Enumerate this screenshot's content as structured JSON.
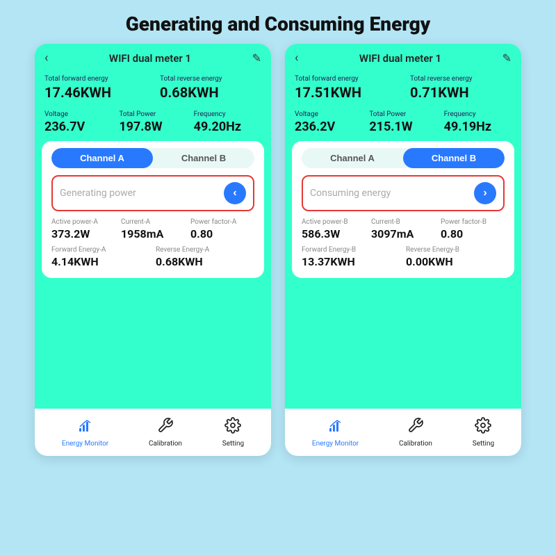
{
  "page": {
    "title": "Generating and Consuming Energy",
    "background": "#b3e5f5"
  },
  "phone_left": {
    "header": {
      "back": "‹",
      "title": "WIFI dual meter 1",
      "edit": "✎"
    },
    "total_forward_label": "Total  forward energy",
    "total_forward_value": "17.46KWH",
    "total_reverse_label": "Total reverse energy",
    "total_reverse_value": "0.68KWH",
    "voltage_label": "Voltage",
    "voltage_value": "236.7V",
    "power_label": "Total Power",
    "power_value": "197.8W",
    "freq_label": "Frequency",
    "freq_value": "49.20Hz",
    "tab_a": "Channel A",
    "tab_b": "Channel B",
    "active_tab": "A",
    "direction_label": "Generating power",
    "direction_btn": "‹",
    "active_power_label": "Active power-A",
    "active_power_value": "373.2W",
    "current_label": "Current-A",
    "current_value": "1958mA",
    "pf_label": "Power factor-A",
    "pf_value": "0.80",
    "fwd_energy_label": "Forward Energy-A",
    "fwd_energy_value": "4.14KWH",
    "rev_energy_label": "Reverse Energy-A",
    "rev_energy_value": "0.68KWH",
    "footer": {
      "monitor_label": "Energy Monitor",
      "calibration_label": "Calibration",
      "setting_label": "Setting",
      "active": "monitor"
    }
  },
  "phone_right": {
    "header": {
      "back": "‹",
      "title": "WIFI dual meter 1",
      "edit": "✎"
    },
    "total_forward_label": "Total  forward energy",
    "total_forward_value": "17.51KWH",
    "total_reverse_label": "Total reverse energy",
    "total_reverse_value": "0.71KWH",
    "voltage_label": "Voltage",
    "voltage_value": "236.2V",
    "power_label": "Total Power",
    "power_value": "215.1W",
    "freq_label": "Frequency",
    "freq_value": "49.19Hz",
    "tab_a": "Channel A",
    "tab_b": "Channel B",
    "active_tab": "B",
    "direction_label": "Consuming energy",
    "direction_btn": "›",
    "active_power_label": "Active power-B",
    "active_power_value": "586.3W",
    "current_label": "Current-B",
    "current_value": "3097mA",
    "pf_label": "Power factor-B",
    "pf_value": "0.80",
    "fwd_energy_label": "Forward Energy-B",
    "fwd_energy_value": "13.37KWH",
    "rev_energy_label": "Reverse Energy-B",
    "rev_energy_value": "0.00KWH",
    "footer": {
      "monitor_label": "Energy Monitor",
      "calibration_label": "Calibration",
      "setting_label": "Setting",
      "active": "monitor"
    }
  }
}
